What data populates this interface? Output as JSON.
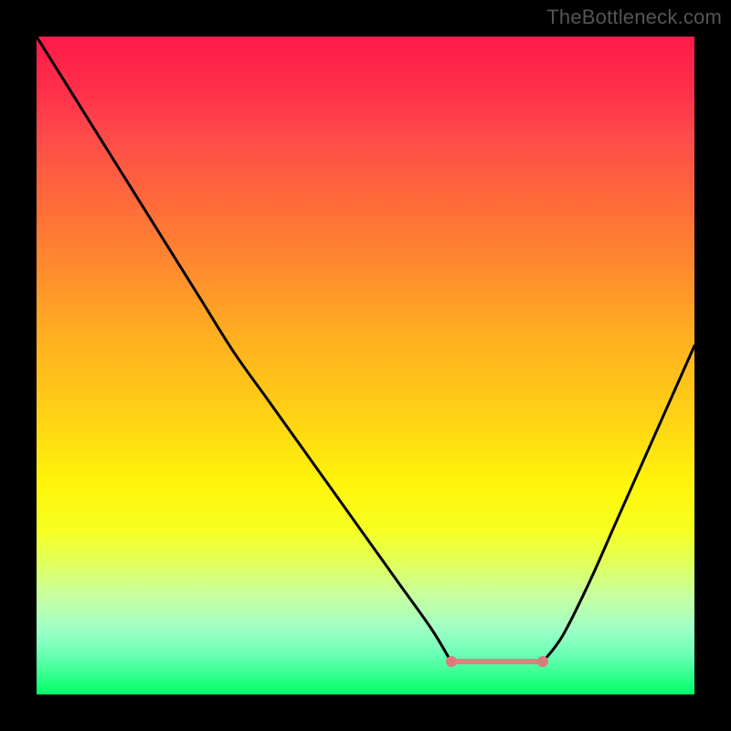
{
  "watermark": "TheBottleneck.com",
  "colors": {
    "frame": "#000000",
    "curve_stroke": "#000000",
    "flat_region": "#e08080",
    "end_dot": "#e07a7a"
  },
  "chart_data": {
    "type": "line",
    "title": "",
    "xlabel": "",
    "ylabel": "",
    "xlim": [
      0,
      100
    ],
    "ylim": [
      0,
      100
    ],
    "description": "Bottleneck curve: left branch descends steeply from top-left to a flat optimal zone near x≈63–77, then a right branch rises toward the right edge. Color gradient encodes bottleneck severity (red=high, green=low).",
    "flat_region": {
      "x_start": 63,
      "x_end": 77,
      "y": 5
    },
    "series": [
      {
        "name": "left-branch",
        "x": [
          0,
          5,
          10,
          15,
          20,
          25,
          30,
          35,
          40,
          45,
          50,
          55,
          60,
          63
        ],
        "values": [
          100,
          92,
          84,
          76,
          68,
          60,
          52,
          45,
          38,
          31,
          24,
          17,
          10,
          5
        ]
      },
      {
        "name": "right-branch",
        "x": [
          77,
          80,
          84,
          88,
          92,
          96,
          100
        ],
        "values": [
          5,
          9,
          17,
          26,
          35,
          44,
          53
        ]
      }
    ],
    "gradient_stops": [
      {
        "pct": 0,
        "color": "#ff1a4a"
      },
      {
        "pct": 25,
        "color": "#ff6a3a"
      },
      {
        "pct": 50,
        "color": "#ffc018"
      },
      {
        "pct": 75,
        "color": "#f6ff20"
      },
      {
        "pct": 100,
        "color": "#00ff66"
      }
    ]
  }
}
